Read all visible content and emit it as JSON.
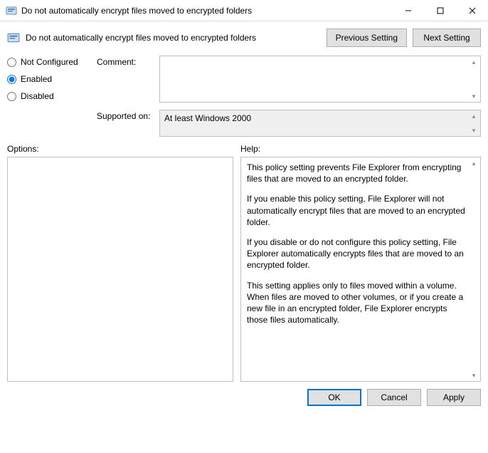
{
  "window": {
    "title": "Do not automatically encrypt files moved to encrypted folders"
  },
  "header": {
    "title": "Do not automatically encrypt files moved to encrypted folders",
    "prev": "Previous Setting",
    "next": "Next Setting"
  },
  "state": {
    "not_configured": "Not Configured",
    "enabled": "Enabled",
    "disabled": "Disabled",
    "selected": "enabled"
  },
  "fields": {
    "comment_label": "Comment:",
    "comment_value": "",
    "supported_label": "Supported on:",
    "supported_value": "At least Windows 2000"
  },
  "panes": {
    "options_label": "Options:",
    "help_label": "Help:",
    "help_p1": "This policy setting prevents File Explorer from encrypting files that are moved to an encrypted folder.",
    "help_p2": "If you enable this policy setting, File Explorer will not automatically encrypt files that are moved to an encrypted folder.",
    "help_p3": "If you disable or do not configure this policy setting, File Explorer automatically encrypts files that are moved to an encrypted folder.",
    "help_p4": "This setting applies only to files moved within a volume. When files are moved to other volumes, or if you create a new file in an encrypted folder, File Explorer encrypts those files automatically."
  },
  "footer": {
    "ok": "OK",
    "cancel": "Cancel",
    "apply": "Apply"
  }
}
